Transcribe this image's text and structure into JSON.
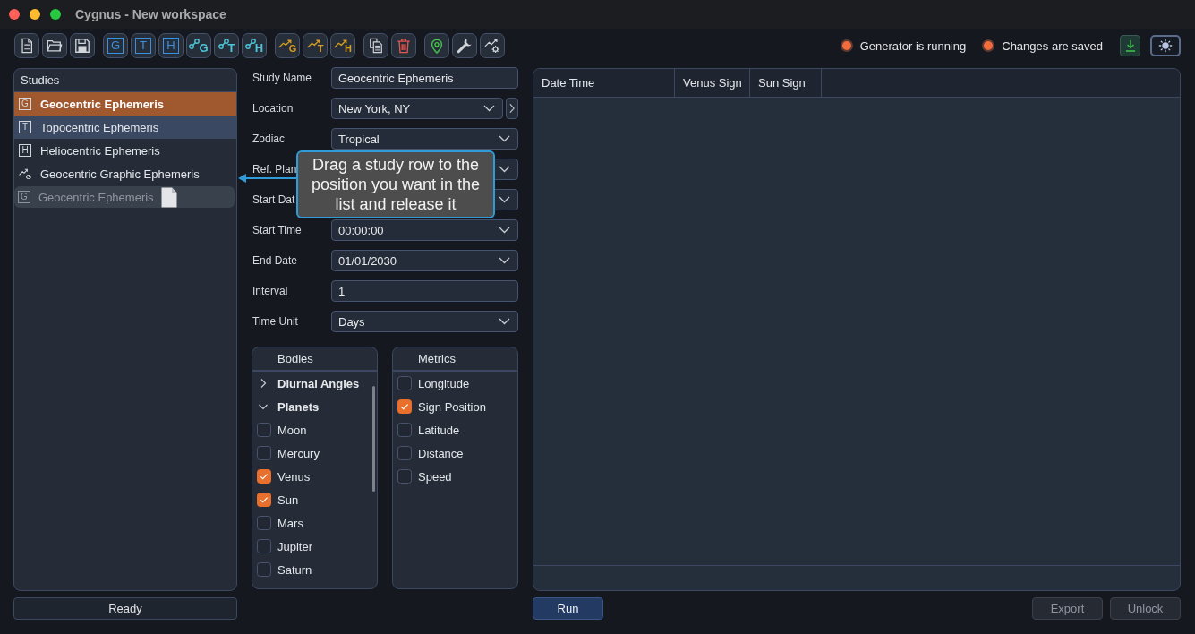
{
  "window": {
    "title": "Cygnus - New workspace"
  },
  "toolbar": {
    "groups": [
      [
        {
          "kind": "new-file"
        },
        {
          "kind": "open"
        },
        {
          "kind": "save"
        }
      ],
      [
        {
          "kind": "letter-box",
          "letter": "G"
        },
        {
          "kind": "letter-box",
          "letter": "T"
        },
        {
          "kind": "letter-box",
          "letter": "H"
        },
        {
          "kind": "node-letter",
          "letter": "G"
        },
        {
          "kind": "node-letter",
          "letter": "T"
        },
        {
          "kind": "node-letter",
          "letter": "H"
        }
      ],
      [
        {
          "kind": "chart-letter",
          "letter": "G"
        },
        {
          "kind": "chart-letter",
          "letter": "T"
        },
        {
          "kind": "chart-letter",
          "letter": "H"
        }
      ],
      [
        {
          "kind": "copy"
        },
        {
          "kind": "trash"
        }
      ],
      [
        {
          "kind": "pin"
        },
        {
          "kind": "wrench"
        },
        {
          "kind": "chart-gear"
        }
      ]
    ]
  },
  "status": [
    {
      "label": "Generator is running",
      "color": "#f26b3c"
    },
    {
      "label": "Changes are saved",
      "color": "#f26b3c"
    }
  ],
  "studies": {
    "title": "Studies",
    "items": [
      {
        "kind": "letter",
        "letter": "G",
        "label": "Geocentric Ephemeris",
        "selected": true,
        "hovered": false
      },
      {
        "kind": "letter",
        "letter": "T",
        "label": "Topocentric Ephemeris",
        "selected": false,
        "hovered": true
      },
      {
        "kind": "letter",
        "letter": "H",
        "label": "Heliocentric Ephemeris",
        "selected": false,
        "hovered": false
      },
      {
        "kind": "chart",
        "letter": "G",
        "label": "Geocentric Graphic Ephemeris",
        "selected": false,
        "hovered": false
      }
    ],
    "drag_ghost": {
      "letter": "G",
      "label": "Geocentric Ephemeris"
    }
  },
  "tooltip": {
    "text": "Drag a study row to the position you want in the list and release it"
  },
  "form": {
    "fields": [
      {
        "label": "Study Name",
        "kind": "text",
        "value": "Geocentric Ephemeris",
        "side_button": false
      },
      {
        "label": "Location",
        "kind": "dropdown",
        "value": "New York, NY",
        "side_button": true
      },
      {
        "label": "Zodiac",
        "kind": "dropdown",
        "value": "Tropical",
        "side_button": false
      },
      {
        "label": "Ref. Plan",
        "kind": "dropdown",
        "side_button": false
      },
      {
        "label": "Start Dat",
        "kind": "dropdown",
        "side_button": false
      },
      {
        "label": "Start Time",
        "kind": "dropdown",
        "value": "00:00:00",
        "side_button": false
      },
      {
        "label": "End Date",
        "kind": "dropdown",
        "value": "01/01/2030",
        "side_button": false
      },
      {
        "label": "Interval",
        "kind": "text",
        "value": "1",
        "side_button": false
      },
      {
        "label": "Time Unit",
        "kind": "dropdown",
        "value": "Days",
        "side_button": false
      }
    ]
  },
  "bodies": {
    "title": "Bodies",
    "items": [
      {
        "label": "Diurnal Angles",
        "expanded": false
      },
      {
        "label": "Planets",
        "expanded": true,
        "children": [
          {
            "label": "Moon",
            "checked": false
          },
          {
            "label": "Mercury",
            "checked": false
          },
          {
            "label": "Venus",
            "checked": true
          },
          {
            "label": "Sun",
            "checked": true
          },
          {
            "label": "Mars",
            "checked": false
          },
          {
            "label": "Jupiter",
            "checked": false
          },
          {
            "label": "Saturn",
            "checked": false
          }
        ]
      }
    ]
  },
  "metrics": {
    "title": "Metrics",
    "items": [
      {
        "label": "Longitude",
        "checked": false
      },
      {
        "label": "Sign Position",
        "checked": true
      },
      {
        "label": "Latitude",
        "checked": false
      },
      {
        "label": "Distance",
        "checked": false
      },
      {
        "label": "Speed",
        "checked": false
      }
    ]
  },
  "table": {
    "columns": [
      "Date Time",
      "Venus Sign",
      "Sun Sign"
    ]
  },
  "status_bar": {
    "text": "Ready"
  },
  "bottom_bar": {
    "left": [
      {
        "label": "Run",
        "disabled": false
      }
    ],
    "right": [
      {
        "label": "Export",
        "disabled": true
      },
      {
        "label": "Unlock",
        "disabled": true
      }
    ]
  }
}
